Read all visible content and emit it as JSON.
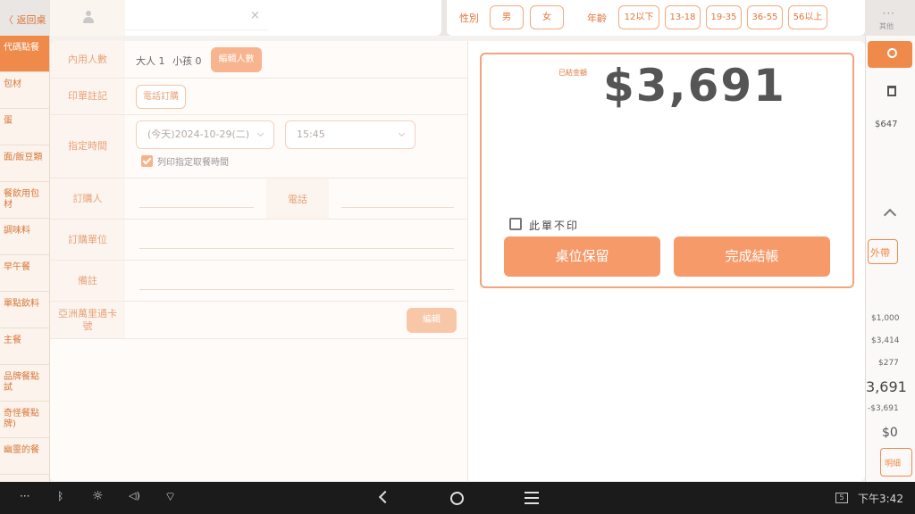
{
  "background_app": {
    "back_label": "〈 返回桌",
    "menu_label": "其他",
    "menu_dots": "···",
    "nav_items": [
      "代碼點餐",
      "包材",
      "蛋",
      "面/飯豆類",
      "餐飲用包材",
      "調味料",
      "早午餐",
      "單點飲料",
      "主餐",
      "品牌餐點試",
      "奇怪餐點牌)",
      "幽靈的餐"
    ],
    "right_panel": {
      "item_price": "$647",
      "takeout_label": "外帶",
      "amount_1": "$1,000",
      "amount_2": "$3,414",
      "amount_3": "$277",
      "big_total": "3,691",
      "neg_total": "-$3,691",
      "zero_label": "$0",
      "bottom_button": "明細"
    }
  },
  "customer_bar": {
    "clear_icon": "×",
    "search_value": ""
  },
  "attributes": {
    "gender_label": "性別",
    "gender_options": [
      "男",
      "女"
    ],
    "age_label": "年齡",
    "age_options": [
      "12以下",
      "13-18",
      "19-35",
      "36-55",
      "56以上"
    ]
  },
  "form": {
    "dine_in_label": "內用人數",
    "adults_text": "大人 1",
    "kids_text": "小孩 0",
    "edit_count_button": "編輯人數",
    "note_label": "印單註記",
    "phone_order_button": "電話訂購",
    "time_label": "指定時間",
    "date_value": "(今天)2024-10-29(二)",
    "time_value": "15:45",
    "print_pickup_label": "列印指定取餐時間",
    "print_pickup_checked": true,
    "orderer_label": "訂購人",
    "phone_label": "電話",
    "org_label": "訂購單位",
    "remark_label": "備註",
    "card_label": "亞洲萬里通卡號",
    "card_edit_button": "編輯"
  },
  "checkout": {
    "paid_label": "已結金額",
    "amount": "$3,691",
    "no_print_label": "此單不印",
    "no_print_checked": false,
    "hold_table_button": "桌位保留",
    "complete_button": "完成結帳"
  },
  "system_bar": {
    "more_icon": "···",
    "bluetooth_icon": "ᛒ",
    "brightness_icon": "☼",
    "volume_icon": "◁)",
    "wifi_icon": "⌔",
    "badge": "5",
    "clock": "下午3:42"
  },
  "colors": {
    "accent": "#f69a6a",
    "accent_text": "#e2773a",
    "muted_accent": "#f7c7a8"
  }
}
